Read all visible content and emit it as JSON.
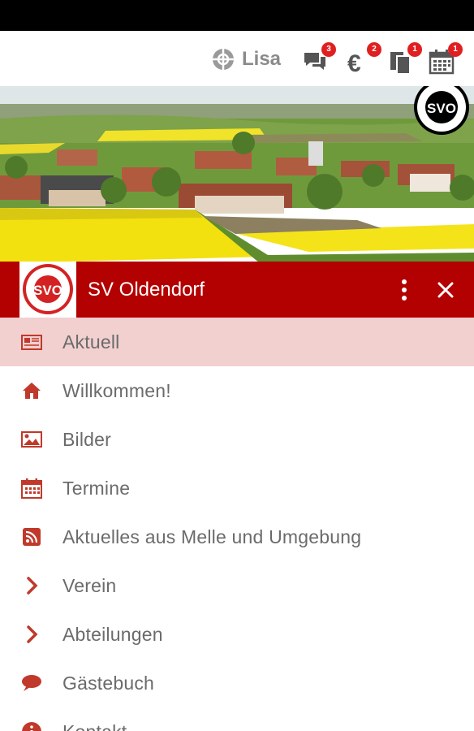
{
  "topbar": {
    "user_name": "Lisa",
    "icons": [
      {
        "name": "messages-icon",
        "badge": "3"
      },
      {
        "name": "euro-icon",
        "badge": "2",
        "glyph": "€"
      },
      {
        "name": "documents-icon",
        "badge": "1"
      },
      {
        "name": "calendar-icon",
        "badge": "1"
      }
    ]
  },
  "header": {
    "logo_text": "SVO",
    "logo_ring_top": "SPORTVEREINIGUNG",
    "logo_ring_bottom": "OLDENDORF e.V.",
    "title": "SV Oldendorf"
  },
  "menu": {
    "items": [
      {
        "label": "Aktuell",
        "icon": "newspaper-icon",
        "active": true
      },
      {
        "label": "Willkommen!",
        "icon": "home-icon"
      },
      {
        "label": "Bilder",
        "icon": "picture-icon"
      },
      {
        "label": "Termine",
        "icon": "calendar-icon"
      },
      {
        "label": "Aktuelles aus Melle und Umgebung",
        "icon": "rss-icon"
      },
      {
        "label": "Verein",
        "icon": "chevron-right-icon"
      },
      {
        "label": "Abteilungen",
        "icon": "chevron-right-icon"
      },
      {
        "label": "Gästebuch",
        "icon": "speech-bubble-icon"
      },
      {
        "label": "Kontakt",
        "icon": "info-icon"
      }
    ]
  },
  "colors": {
    "brand": "#b30000",
    "active_row": "#f2d0d0",
    "icon_red": "#c0392b",
    "badge": "#e02020"
  }
}
